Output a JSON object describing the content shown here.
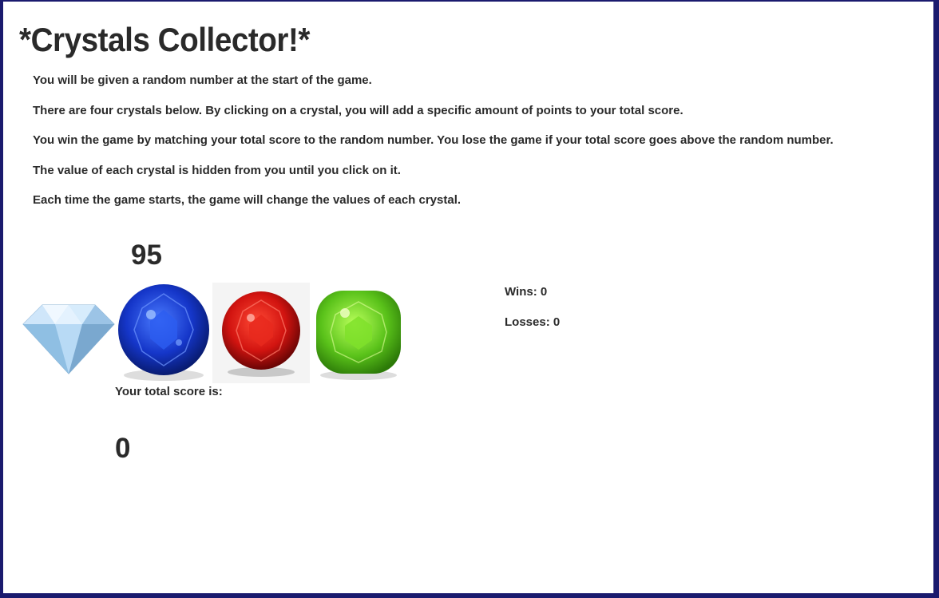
{
  "title": "*Crystals Collector!*",
  "rules": [
    "You will be given a random number at the start of the game.",
    "There are four crystals below. By clicking on a crystal, you will add a specific amount of points to your total score.",
    "You win the game by matching your total score to the random number. You lose the game if your total score goes above the random number.",
    "The value of each crystal is hidden from you until you click on it.",
    "Each time the game starts, the game will change the values of each crystal."
  ],
  "target_number": "95",
  "crystals": [
    {
      "icon": "diamond-crystal-icon",
      "color": "#a9d4f5"
    },
    {
      "icon": "blue-sapphire-crystal-icon",
      "color": "#1536c9"
    },
    {
      "icon": "red-ruby-crystal-icon",
      "color": "#d21410"
    },
    {
      "icon": "green-peridot-crystal-icon",
      "color": "#5ac21a"
    }
  ],
  "score_label": "Your total score is:",
  "score_value": "0",
  "wins": "Wins: 0",
  "losses": "Losses: 0"
}
